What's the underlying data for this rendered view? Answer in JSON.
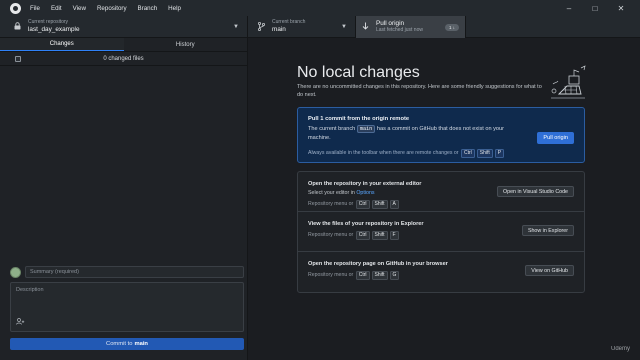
{
  "menu": [
    "File",
    "Edit",
    "View",
    "Repository",
    "Branch",
    "Help"
  ],
  "window_controls": [
    "–",
    "□",
    "✕"
  ],
  "toolbar": {
    "repo_label": "Current repository",
    "repo_value": "last_day_example",
    "branch_label": "Current branch",
    "branch_value": "main",
    "pull_label": "Pull origin",
    "pull_sub": "Last fetched just now",
    "pull_badge": "1 ↓"
  },
  "sidebar": {
    "tabs": [
      "Changes",
      "History"
    ],
    "changes_count": "0 changed files",
    "summary_placeholder": "Summary (required)",
    "description_placeholder": "Description",
    "commit_prefix": "Commit to",
    "commit_branch": "main"
  },
  "main": {
    "title": "No local changes",
    "subtitle": "There are no uncommitted changes in this repository. Here are some friendly suggestions for what to do next.",
    "pull_card": {
      "title": "Pull 1 commit from the origin remote",
      "body_pre": "The current branch",
      "branch": "main",
      "body_post": "has a commit on GitHub that does not exist on your machine.",
      "hint": "Always available in the toolbar when there are remote changes or",
      "keys": [
        "Ctrl",
        "Shift",
        "P"
      ],
      "button": "Pull origin"
    },
    "actions": [
      {
        "title": "Open the repository in your external editor",
        "sub_pre": "Select your editor in",
        "sub_link": "Options",
        "hint": "Repository menu or",
        "keys": [
          "Ctrl",
          "Shift",
          "A"
        ],
        "button": "Open in Visual Studio Code"
      },
      {
        "title": "View the files of your repository in Explorer",
        "hint": "Repository menu or",
        "keys": [
          "Ctrl",
          "Shift",
          "F"
        ],
        "button": "Show in Explorer"
      },
      {
        "title": "Open the repository page on GitHub in your browser",
        "hint": "Repository menu or",
        "keys": [
          "Ctrl",
          "Shift",
          "G"
        ],
        "button": "View on GitHub"
      }
    ]
  },
  "watermark": "Udemy",
  "colors": {
    "accent": "#2f6fd6",
    "pull_card_bg": "#0f2a4d",
    "link": "#58a6ff"
  },
  "icons": {
    "repo": "lock-icon",
    "branch": "git-branch-icon",
    "pull": "arrow-down-icon",
    "coauthor": "person-add-icon"
  }
}
